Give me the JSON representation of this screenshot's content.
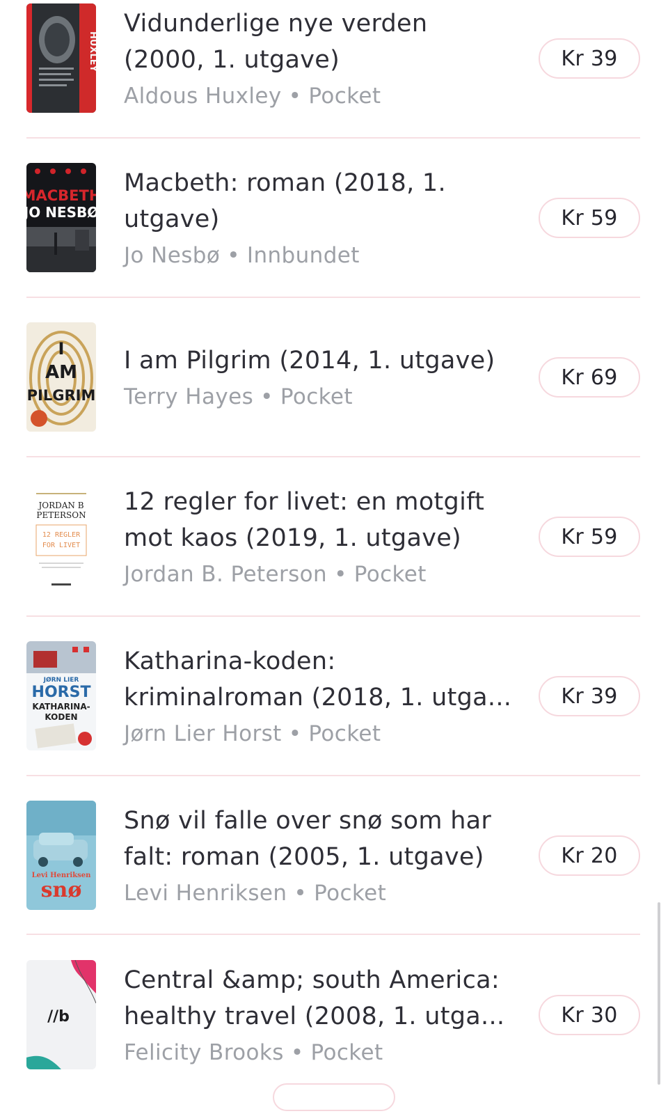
{
  "books": [
    {
      "title": "Vidunderlige nye verden\n(2000, 1. utgave)",
      "author": "Aldous Huxley",
      "separator": "•",
      "format": "Pocket",
      "price": "Kr 39",
      "cover_text": "HUXLEY"
    },
    {
      "title": "Macbeth: roman (2018, 1.\nutgave)",
      "author": "Jo Nesbø",
      "separator": "•",
      "format": "Innbundet",
      "price": "Kr 59",
      "cover_text_1": "MACBETH",
      "cover_text_2": "JO NESBØ"
    },
    {
      "title": "I am Pilgrim (2014, 1. utgave)",
      "author": "Terry Hayes",
      "separator": "•",
      "format": "Pocket",
      "price": "Kr 69",
      "cover_text_1": "I",
      "cover_text_2": "AM",
      "cover_text_3": "PILGRIM"
    },
    {
      "title": "12 regler for livet: en motgift\nmot kaos (2019, 1. utgave)",
      "author": "Jordan B. Peterson",
      "separator": "•",
      "format": "Pocket",
      "price": "Kr 59",
      "cover_text_1": "JORDAN B",
      "cover_text_2": "PETERSON",
      "cover_text_3": "12 REGLER",
      "cover_text_4": "FOR LIVET"
    },
    {
      "title": "Katharina-koden:\nkriminalroman (2018, 1. utga...",
      "author": "Jørn Lier Horst",
      "separator": "•",
      "format": "Pocket",
      "price": "Kr 39",
      "cover_text_1": "JØRN LIER",
      "cover_text_2": "HORST",
      "cover_text_3": "KATHARINA-",
      "cover_text_4": "KODEN"
    },
    {
      "title": "Snø vil falle over snø som har\nfalt: roman (2005, 1. utgave)",
      "author": "Levi Henriksen",
      "separator": "•",
      "format": "Pocket",
      "price": "Kr 20",
      "cover_text_1": "Levi Henriksen",
      "cover_text_2": "snø"
    },
    {
      "title": "Central &amp; south America:\nhealthy travel (2008, 1. utga...",
      "author": "Felicity Brooks",
      "separator": "•",
      "format": "Pocket",
      "price": "Kr 30",
      "cover_text_1": "//b"
    }
  ],
  "colors": {
    "accent_border": "#f6d8de",
    "divider": "#f7dfe3",
    "meta_text": "#9da0a6"
  }
}
